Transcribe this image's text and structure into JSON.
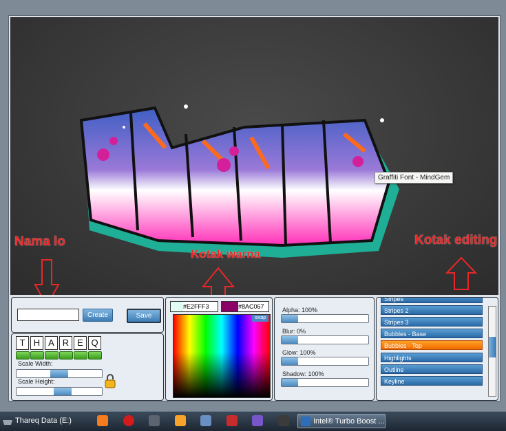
{
  "canvas": {
    "graffiti_text": "THAREQ",
    "tooltip": "Graffiti Font - MindGem"
  },
  "annotations": {
    "name_label": "Nama lo",
    "color_label": "Kotak warna",
    "edit_label": "Kotak editing"
  },
  "name_panel": {
    "input_value": "",
    "create_label": "Create",
    "save_label": "Save"
  },
  "letters_panel": {
    "letters": [
      "T",
      "H",
      "A",
      "R",
      "E",
      "Q"
    ],
    "scale_width_label": "Scale Width:",
    "scale_height_label": "Scale Height:",
    "scale_width_value": 0.5,
    "scale_height_value": 0.55
  },
  "color_panel": {
    "color1": "#E2FFF3",
    "color2": "#8AC067",
    "color1_swatch": "#E2FFF3",
    "color2_swatch": "#8A0067",
    "swap_label": "swap"
  },
  "effects_panel": {
    "alpha_label": "Alpha: 100%",
    "blur_label": "Blur: 0%",
    "glow_label": "Glow: 100%",
    "shadow_label": "Shadow: 100%",
    "alpha_value": 1.0,
    "blur_value": 0.0,
    "glow_value": 1.0,
    "shadow_value": 1.0
  },
  "layers_panel": {
    "items": [
      "Stripes",
      "Stripes 2",
      "Stripes 3",
      "Bubbles - Base",
      "Bubbles - Top",
      "Highlights",
      "Outline",
      "Keyline"
    ],
    "selected": "Bubbles - Top"
  },
  "taskbar": {
    "start_item": "Thareq Data (E:)",
    "active_item": "Intel® Turbo Boost ..."
  },
  "colors": {
    "accent": "#ea2727",
    "selected_item": "#f26b00"
  }
}
